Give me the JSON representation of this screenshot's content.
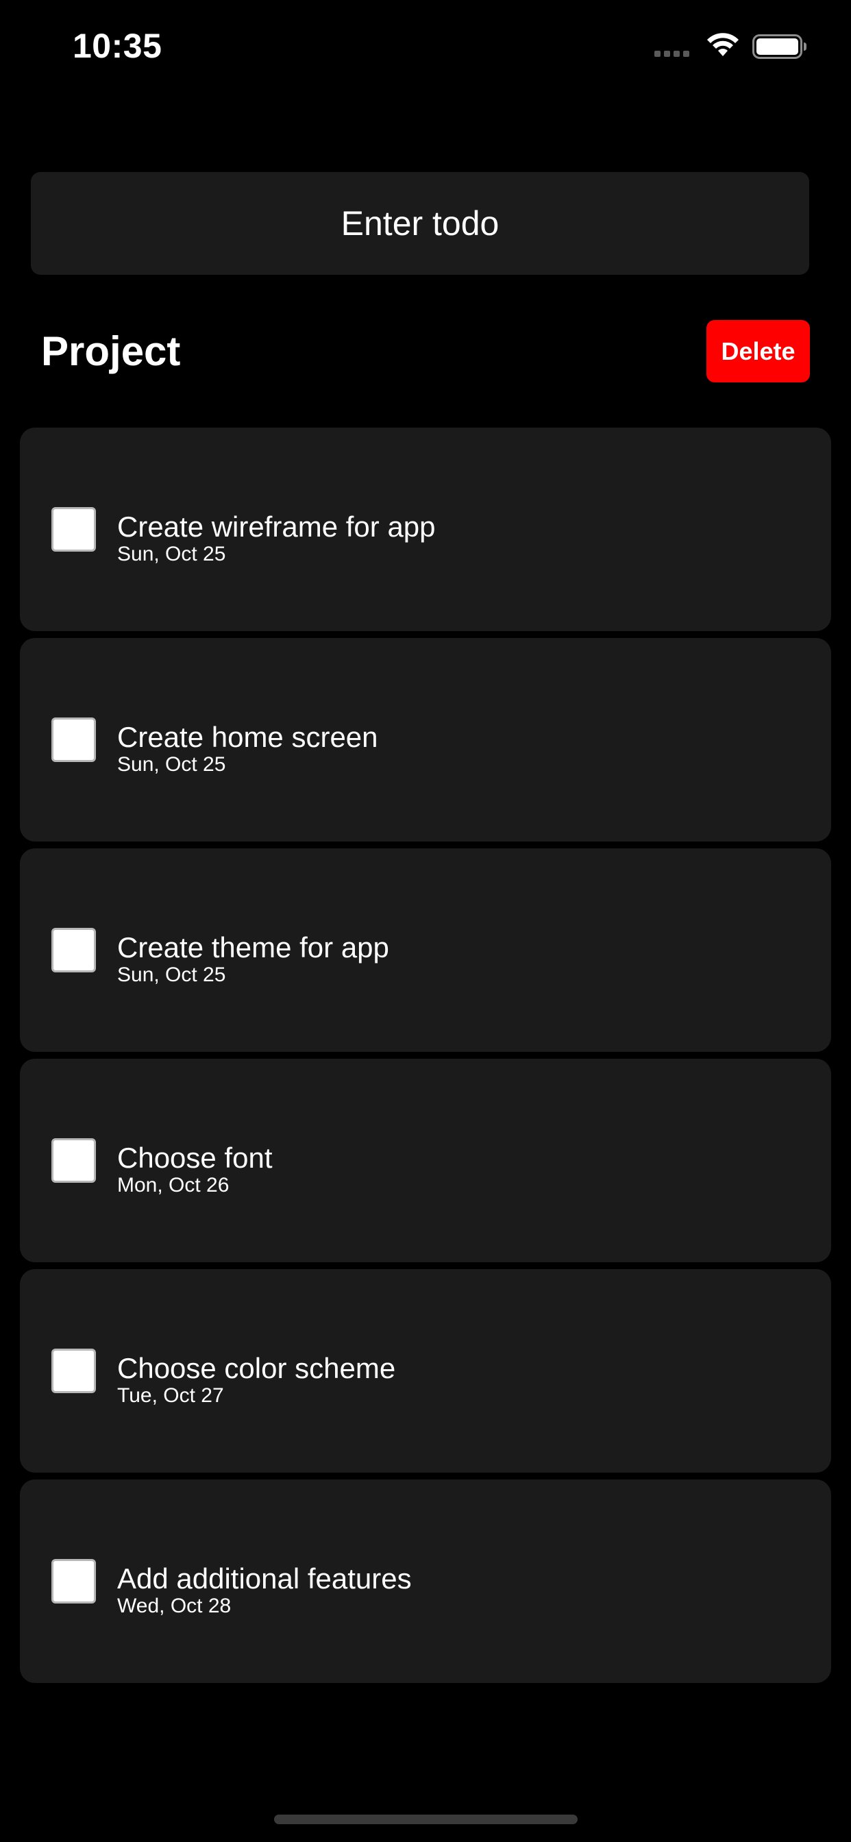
{
  "status_bar": {
    "time": "10:35",
    "icons": [
      "cellular-signal-icon",
      "wifi-icon",
      "battery-icon"
    ]
  },
  "input": {
    "placeholder": "Enter todo",
    "value": ""
  },
  "header": {
    "title": "Project",
    "delete_label": "Delete"
  },
  "todos": [
    {
      "title": "Create wireframe for app",
      "date": "Sun, Oct 25",
      "checked": false
    },
    {
      "title": "Create home screen",
      "date": "Sun, Oct 25",
      "checked": false
    },
    {
      "title": "Create theme for app",
      "date": "Sun, Oct 25",
      "checked": false
    },
    {
      "title": "Choose font",
      "date": "Mon, Oct 26",
      "checked": false
    },
    {
      "title": "Choose color scheme",
      "date": "Tue, Oct 27",
      "checked": false
    },
    {
      "title": "Add additional features",
      "date": "Wed, Oct 28",
      "checked": false
    }
  ],
  "colors": {
    "background": "#000000",
    "card": "#1b1b1b",
    "delete_button": "#ff0000",
    "text": "#ffffff"
  }
}
